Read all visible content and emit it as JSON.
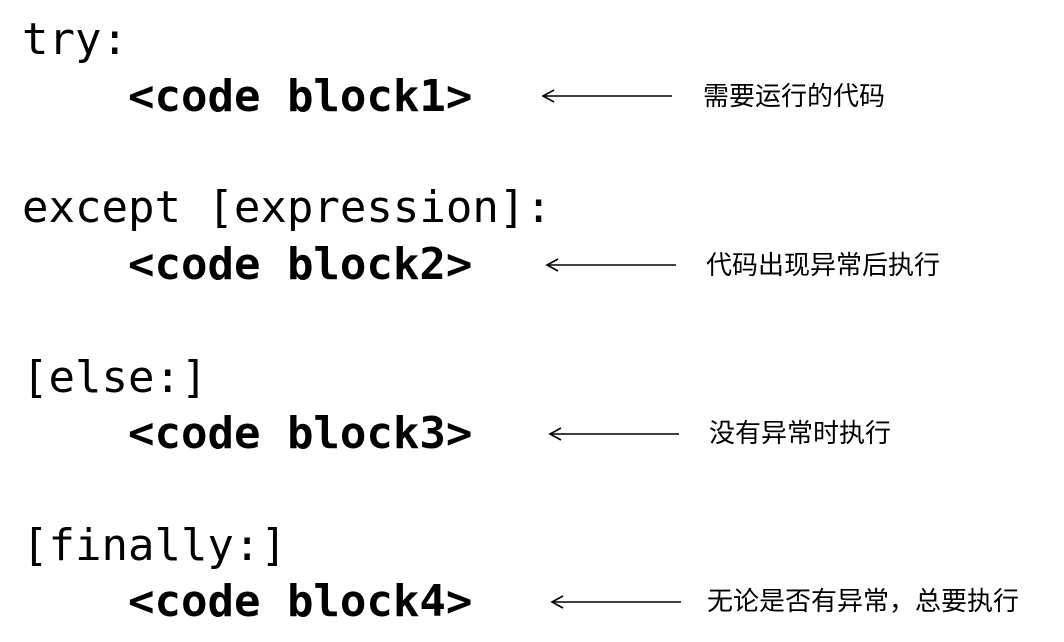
{
  "lines": {
    "try_kw": "try:",
    "block1": "<code block1>",
    "except_kw": "except [expression]:",
    "block2": "<code block2>",
    "else_kw": "[else:]",
    "block3": "<code block3>",
    "finally_kw": "[finally:]",
    "block4": "<code block4>"
  },
  "notes": {
    "note1": "需要运行的代码",
    "note2": "代码出现异常后执行",
    "note3": "没有异常时执行",
    "note4": "无论是否有异常，总要执行"
  }
}
